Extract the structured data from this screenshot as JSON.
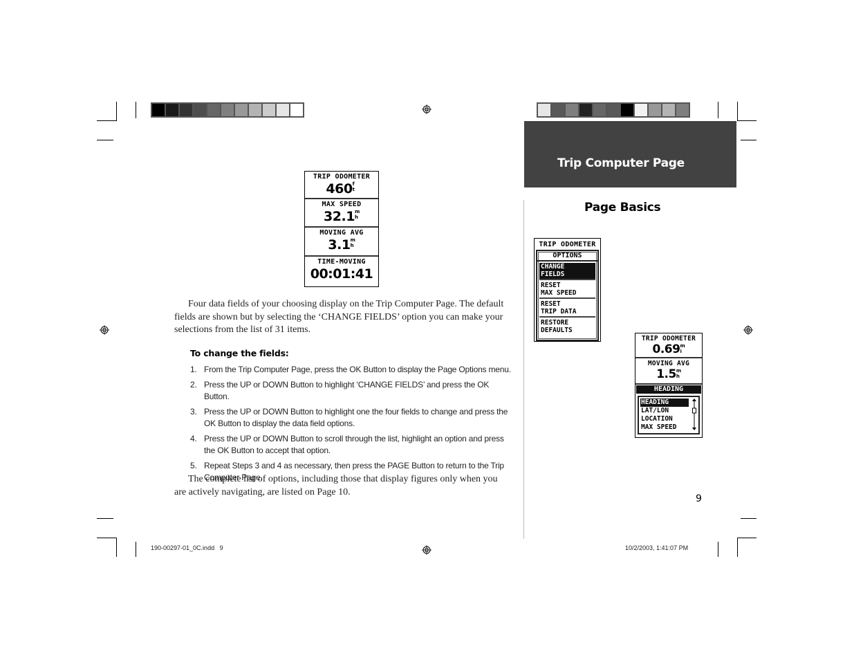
{
  "header": {
    "chapter_title": "Trip Computer Page",
    "section_title": "Page Basics",
    "band_color": "#424242"
  },
  "color_bars": {
    "left": [
      "#000000",
      "#1a1a1a",
      "#333333",
      "#4d4d4d",
      "#666666",
      "#808080",
      "#999999",
      "#b3b3b3",
      "#cccccc",
      "#e6e6e6",
      "#ffffff"
    ],
    "right": [
      "#e6e6e6",
      "#585858",
      "#7f7f7f",
      "#222222",
      "#666666",
      "#585858",
      "#000000",
      "#f2f2f2",
      "#999999",
      "#b3b3b3",
      "#7f7f7f"
    ]
  },
  "screen_main": {
    "fields": [
      {
        "label": "TRIP ODOMETER",
        "value": "460",
        "unit_top": "f",
        "unit_bottom": "t"
      },
      {
        "label": "MAX SPEED",
        "value": "32.1",
        "unit_top": "m",
        "unit_bottom": "h"
      },
      {
        "label": "MOVING AVG",
        "value": "3.1",
        "unit_top": "m",
        "unit_bottom": "h"
      },
      {
        "label": "TIME-MOVING",
        "value": "00:01:41",
        "unit_top": "",
        "unit_bottom": ""
      }
    ]
  },
  "screen_options": {
    "top_label": "TRIP ODOMETER",
    "menu_title": "OPTIONS",
    "options": [
      {
        "line1": "CHANGE",
        "line2": "FIELDS",
        "selected": true
      },
      {
        "line1": "RESET",
        "line2": "MAX SPEED",
        "selected": false
      },
      {
        "line1": "RESET",
        "line2": "TRIP DATA",
        "selected": false
      },
      {
        "line1": "RESTORE",
        "line2": "DEFAULTS",
        "selected": false
      }
    ]
  },
  "screen_fieldlist": {
    "fields": [
      {
        "label": "TRIP ODOMETER",
        "value": "0.69",
        "unit_top": "m",
        "unit_bottom": "i"
      },
      {
        "label": "MOVING AVG",
        "value": "1.5",
        "unit_top": "m",
        "unit_bottom": "h"
      }
    ],
    "heading_label": "HEADING",
    "list_items": [
      {
        "label": "HEADING",
        "selected": true
      },
      {
        "label": "LAT/LON",
        "selected": false
      },
      {
        "label": "LOCATION",
        "selected": false
      },
      {
        "label": "MAX SPEED",
        "selected": false
      }
    ]
  },
  "body": {
    "intro": "Four data fields of your choosing display on the Trip Computer Page. The default fields are shown but by selecting the ‘CHANGE FIELDS’ option you can make your selections from the list of 31 items.",
    "procedure_heading": "To change the fields:",
    "steps": [
      {
        "num": "1.",
        "text": "From the Trip Computer Page, press the OK Button to display the Page Options menu."
      },
      {
        "num": "2.",
        "text": "Press the UP or DOWN Button to highlight ‘CHANGE FIELDS’ and press the OK Button."
      },
      {
        "num": "3.",
        "text": "Press the UP or DOWN Button to highlight one the four fields to change and press the OK Button to display the data field options."
      },
      {
        "num": "4.",
        "text": "Press the UP or DOWN Button to scroll through the list, highlight an option and press the OK Button to accept that option."
      },
      {
        "num": "5.",
        "text": "Repeat Steps 3 and 4 as necessary, then press the PAGE Button to return to the Trip Computer Page."
      }
    ],
    "closing": "The complete list of options, including those that display figures only when you are actively navigating, are listed on Page 10."
  },
  "page_number": "9",
  "footer": {
    "file_slug": "190-00297-01_0C.indd   9",
    "timestamp": "10/2/2003, 1:41:07 PM"
  }
}
